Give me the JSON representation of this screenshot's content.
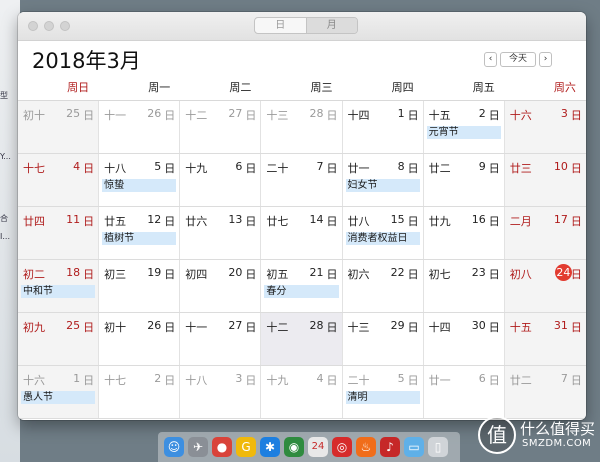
{
  "desktop": {
    "labels": [
      "型",
      "Y...",
      "合",
      "I..."
    ]
  },
  "window": {
    "view_switch": [
      {
        "label": "日",
        "active": false
      },
      {
        "label": "月",
        "active": true
      }
    ],
    "month_title": "2018年3月",
    "nav": {
      "prev": "‹",
      "today": "今天",
      "next": "›"
    }
  },
  "weekdays": [
    {
      "label": "周日",
      "weekend": true
    },
    {
      "label": "周一",
      "weekend": false
    },
    {
      "label": "周二",
      "weekend": false
    },
    {
      "label": "周三",
      "weekend": false
    },
    {
      "label": "周四",
      "weekend": false
    },
    {
      "label": "周五",
      "weekend": false
    },
    {
      "label": "周六",
      "weekend": true
    }
  ],
  "ri": "日",
  "weeks": [
    [
      {
        "lunar": "初十",
        "day": "25",
        "other": true
      },
      {
        "lunar": "十一",
        "day": "26",
        "other": true
      },
      {
        "lunar": "十二",
        "day": "27",
        "other": true
      },
      {
        "lunar": "十三",
        "day": "28",
        "other": true
      },
      {
        "lunar": "十四",
        "day": "1"
      },
      {
        "lunar": "十五",
        "day": "2",
        "event": "元宵节"
      },
      {
        "lunar": "十六",
        "day": "3"
      }
    ],
    [
      {
        "lunar": "十七",
        "day": "4"
      },
      {
        "lunar": "十八",
        "day": "5",
        "event": "惊蛰"
      },
      {
        "lunar": "十九",
        "day": "6"
      },
      {
        "lunar": "二十",
        "day": "7"
      },
      {
        "lunar": "廿一",
        "day": "8",
        "event": "妇女节"
      },
      {
        "lunar": "廿二",
        "day": "9"
      },
      {
        "lunar": "廿三",
        "day": "10"
      }
    ],
    [
      {
        "lunar": "廿四",
        "day": "11"
      },
      {
        "lunar": "廿五",
        "day": "12",
        "event": "植树节"
      },
      {
        "lunar": "廿六",
        "day": "13"
      },
      {
        "lunar": "廿七",
        "day": "14"
      },
      {
        "lunar": "廿八",
        "day": "15",
        "event": "消费者权益日"
      },
      {
        "lunar": "廿九",
        "day": "16"
      },
      {
        "lunar": "二月",
        "day": "17"
      }
    ],
    [
      {
        "lunar": "初二",
        "day": "18",
        "event": "中和节"
      },
      {
        "lunar": "初三",
        "day": "19"
      },
      {
        "lunar": "初四",
        "day": "20"
      },
      {
        "lunar": "初五",
        "day": "21",
        "event": "春分"
      },
      {
        "lunar": "初六",
        "day": "22"
      },
      {
        "lunar": "初七",
        "day": "23"
      },
      {
        "lunar": "初八",
        "day": "24",
        "today": true
      }
    ],
    [
      {
        "lunar": "初九",
        "day": "25"
      },
      {
        "lunar": "初十",
        "day": "26"
      },
      {
        "lunar": "十一",
        "day": "27"
      },
      {
        "lunar": "十二",
        "day": "28",
        "selected": true
      },
      {
        "lunar": "十三",
        "day": "29"
      },
      {
        "lunar": "十四",
        "day": "30"
      },
      {
        "lunar": "十五",
        "day": "31"
      }
    ],
    [
      {
        "lunar": "十六",
        "day": "1",
        "other": true,
        "event": "愚人节"
      },
      {
        "lunar": "十七",
        "day": "2",
        "other": true
      },
      {
        "lunar": "十八",
        "day": "3",
        "other": true
      },
      {
        "lunar": "十九",
        "day": "4",
        "other": true
      },
      {
        "lunar": "二十",
        "day": "5",
        "other": true,
        "event": "清明"
      },
      {
        "lunar": "廿一",
        "day": "6",
        "other": true
      },
      {
        "lunar": "廿二",
        "day": "7",
        "other": true
      }
    ]
  ],
  "dock": [
    {
      "name": "finder-icon",
      "color": "#3d8fe0",
      "glyph": "☺"
    },
    {
      "name": "launchpad-icon",
      "color": "#8a8f96",
      "glyph": "✈"
    },
    {
      "name": "chrome-icon",
      "color": "#d9433a",
      "glyph": "●"
    },
    {
      "name": "g-app-icon",
      "color": "#f0b90b",
      "glyph": "G"
    },
    {
      "name": "star-app-icon",
      "color": "#1d7fe0",
      "glyph": "✱"
    },
    {
      "name": "globe-icon",
      "color": "#2f8b3f",
      "glyph": "◉"
    },
    {
      "name": "calendar-icon",
      "color": "#e8e8e8",
      "glyph": "24"
    },
    {
      "name": "netease-music-icon",
      "color": "#d62b2b",
      "glyph": "◎"
    },
    {
      "name": "flame-app-icon",
      "color": "#f06d1a",
      "glyph": "♨"
    },
    {
      "name": "red-app-icon",
      "color": "#c62828",
      "glyph": "♪"
    },
    {
      "name": "folder-icon",
      "color": "#5fb0e8",
      "glyph": "▭"
    },
    {
      "name": "trash-icon",
      "color": "#d0d4d8",
      "glyph": "▯"
    }
  ],
  "watermark": {
    "glyph": "值",
    "title": "什么值得买",
    "domain": "SMZDM.COM"
  }
}
